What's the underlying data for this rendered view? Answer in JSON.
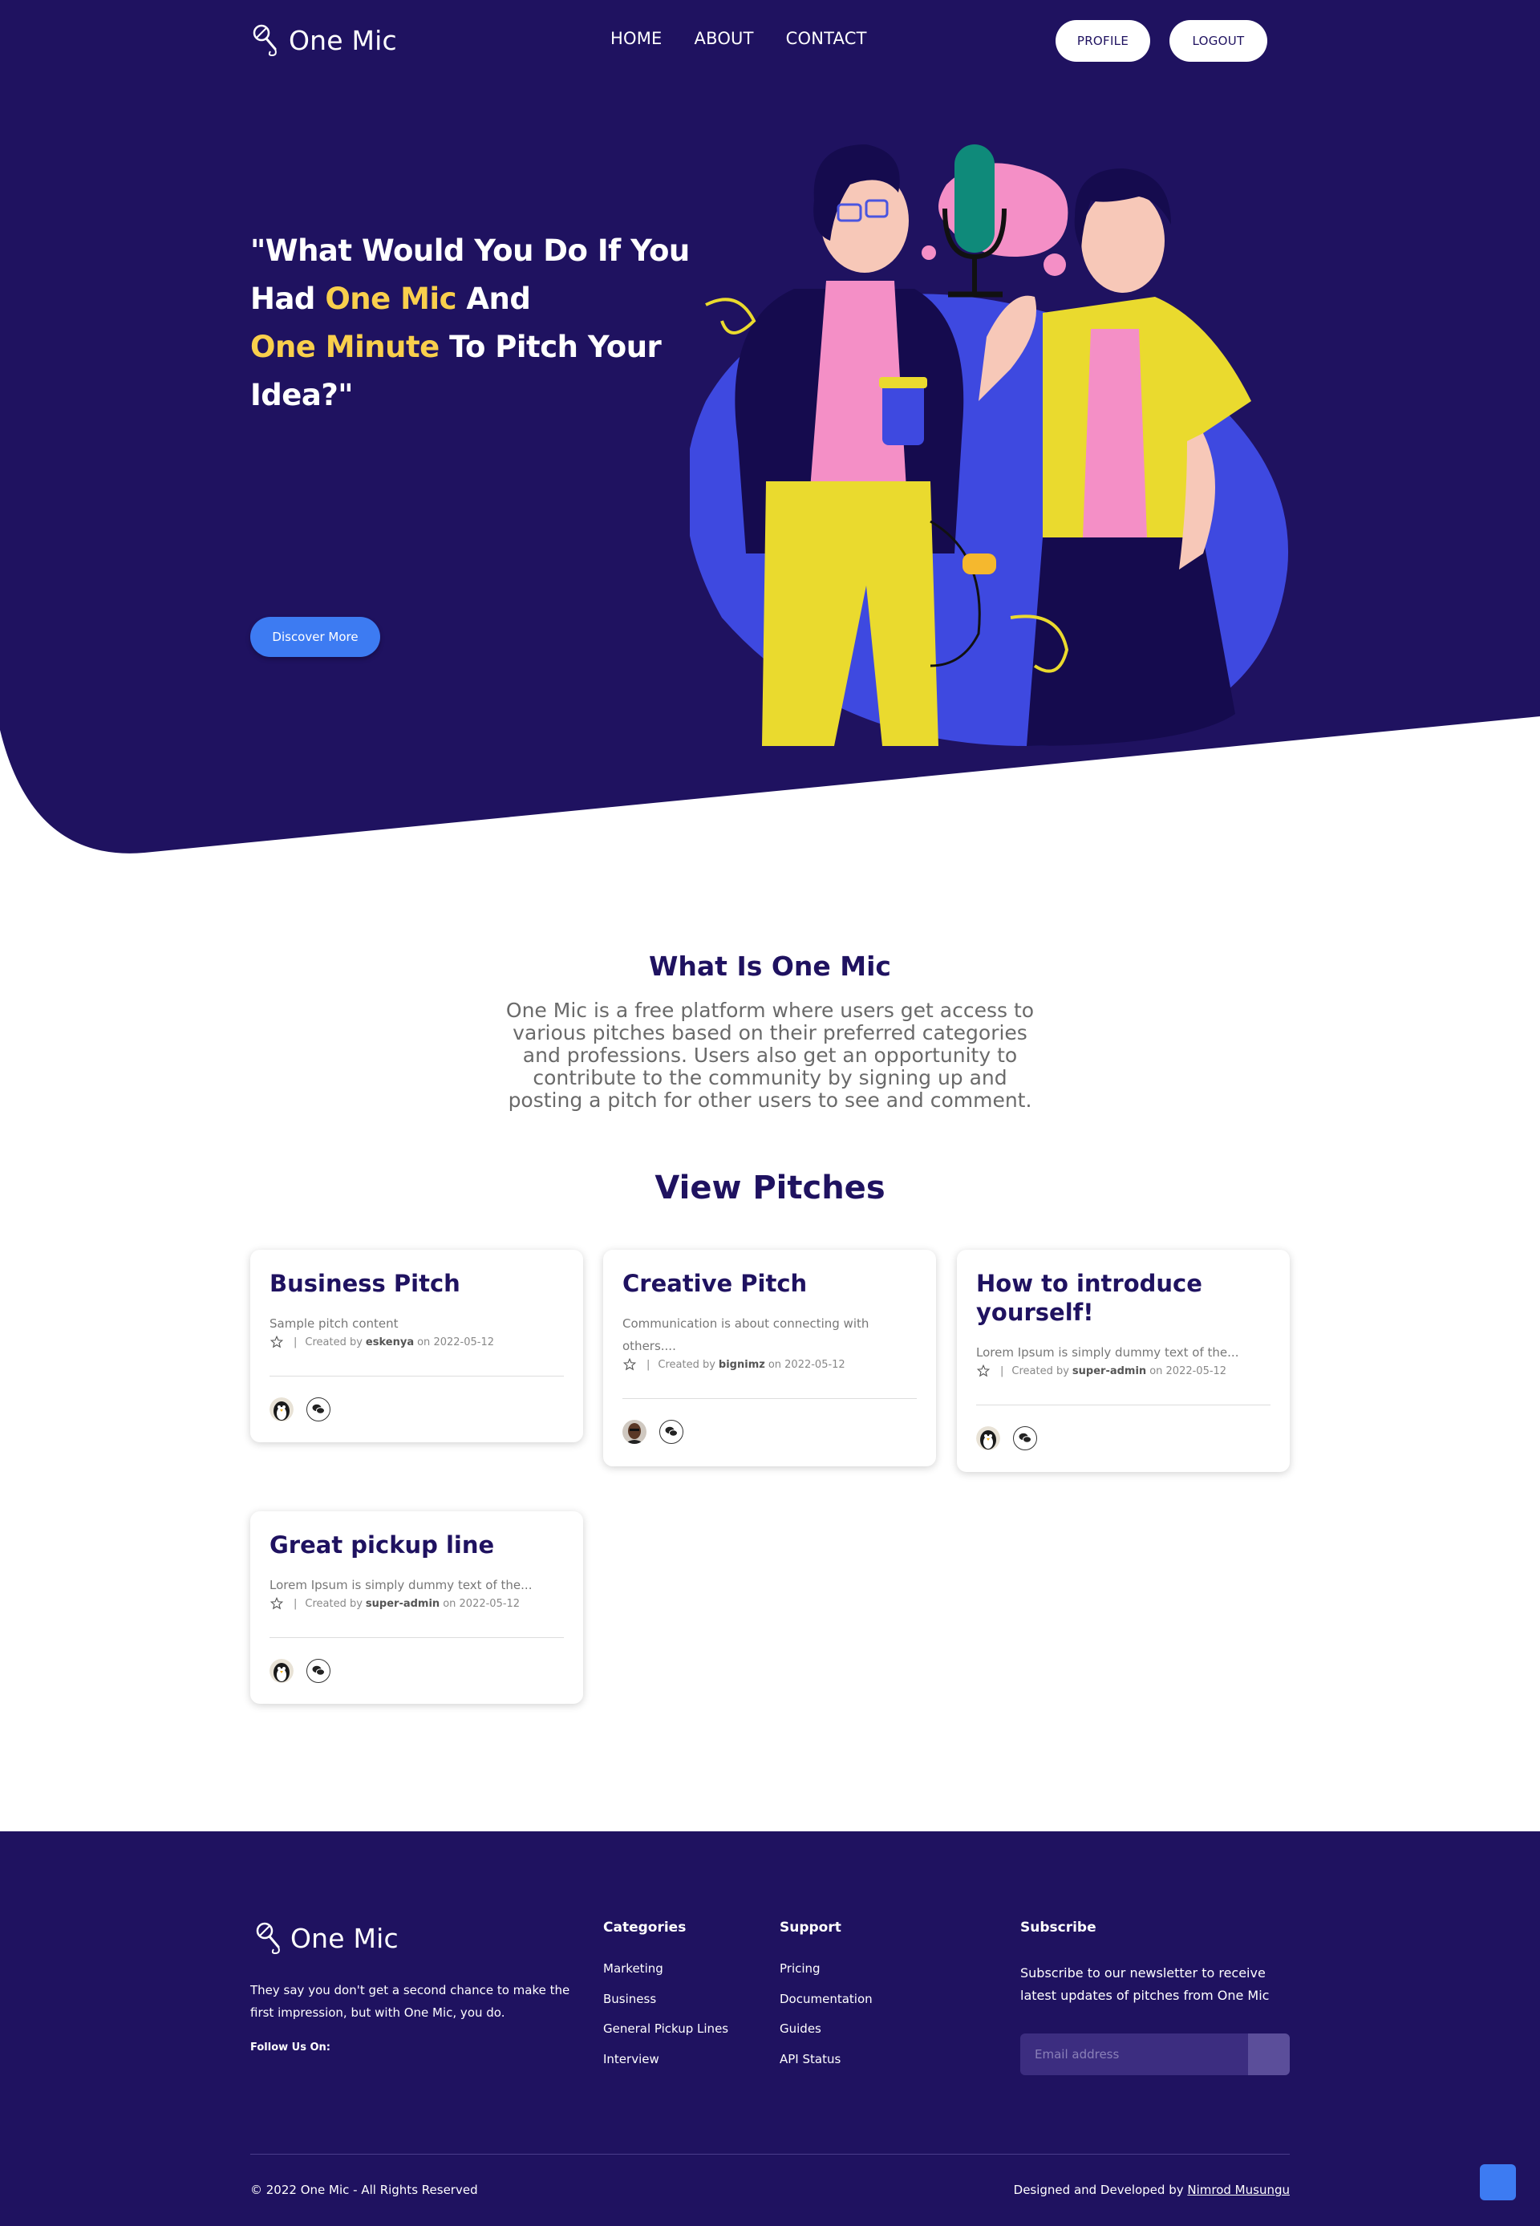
{
  "header": {
    "logo_text": "One Mic",
    "nav": [
      "HOME",
      "ABOUT",
      "CONTACT"
    ],
    "profile_label": "PROFILE",
    "logout_label": "LOGOUT"
  },
  "hero": {
    "title_part1": "\"What Would You Do If You Had ",
    "title_hl1": "One Mic",
    "title_part2": " And ",
    "title_hl2": "One Minute",
    "title_part3": " To Pitch Your Idea?\"",
    "button_label": "Discover More"
  },
  "about": {
    "title": "What Is One Mic",
    "text": "One Mic is a free platform where users get access to various pitches based on their preferred categories and professions. Users also get an opportunity to contribute to the community by signing up and posting a pitch for other users to see and comment."
  },
  "pitches": {
    "title": "View Pitches",
    "created_by": "Created by",
    "on": "on",
    "separator": "|",
    "items": [
      {
        "title": "Business Pitch",
        "desc": "Sample pitch content",
        "author": "eskenya",
        "date": "2022-05-12",
        "avatar": "penguin-avatar"
      },
      {
        "title": "Creative Pitch",
        "desc": "Communication is about connecting with others....",
        "author": "bignimz",
        "date": "2022-05-12",
        "avatar": "photo-avatar"
      },
      {
        "title": "How to introduce yourself!",
        "desc": "Lorem Ipsum is simply dummy text of the...",
        "author": "super-admin",
        "date": "2022-05-12",
        "avatar": "penguin-avatar"
      },
      {
        "title": "Great pickup line",
        "desc": "Lorem Ipsum is simply dummy text of the...",
        "author": "super-admin",
        "date": "2022-05-12",
        "avatar": "penguin-avatar"
      }
    ]
  },
  "footer": {
    "logo_text": "One Mic",
    "tagline": "They say you don't get a second chance to make the first impression, but with One Mic, you do.",
    "follow": "Follow Us On:",
    "categories": {
      "title": "Categories",
      "items": [
        "Marketing",
        "Business",
        "General Pickup Lines",
        "Interview"
      ]
    },
    "support": {
      "title": "Support",
      "items": [
        "Pricing",
        "Documentation",
        "Guides",
        "API Status"
      ]
    },
    "subscribe": {
      "title": "Subscribe",
      "text": "Subscribe to our newsletter to receive latest updates of pitches from One Mic",
      "placeholder": "Email address"
    },
    "copyright": "© 2022 One Mic - All Rights Reserved",
    "credit_prefix": "Designed and Developed by ",
    "credit_name": "Nimrod Musungu"
  },
  "colors": {
    "navy": "#1f1260",
    "accent_yellow": "#f9cf4c",
    "accent_blue": "#3d7bf2"
  }
}
